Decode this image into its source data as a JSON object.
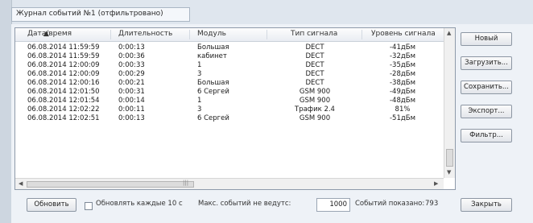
{
  "window": {
    "title": "Журнал событий №1 (отфильтровано)"
  },
  "columns": [
    "Дата/время",
    "Длительность",
    "Модуль",
    "Тип сигнала",
    "Уровень сигнала"
  ],
  "rows": [
    [
      "06.08.2014 11:59:59",
      "0:00:13",
      "Большая",
      "DECT",
      "-41дБм"
    ],
    [
      "06.08.2014 11:59:59",
      "0:00:36",
      "кабинет",
      "DECT",
      "-32дБм"
    ],
    [
      "06.08.2014 12:00:09",
      "0:00:33",
      "1",
      "DECT",
      "-35дБм"
    ],
    [
      "06.08.2014 12:00:09",
      "0:00:29",
      "3",
      "DECT",
      "-28дБм"
    ],
    [
      "06.08.2014 12:00:16",
      "0:00:21",
      "Большая",
      "DECT",
      "-38дБм"
    ],
    [
      "06.08.2014 12:01:50",
      "0:00:31",
      "6 Сергей",
      "GSM 900",
      "-49дБм"
    ],
    [
      "06.08.2014 12:01:54",
      "0:00:14",
      "1",
      "GSM 900",
      "-48дБм"
    ],
    [
      "06.08.2014 12:02:22",
      "0:00:11",
      "3",
      "Трафик 2.4",
      "81%"
    ],
    [
      "06.08.2014 12:02:51",
      "0:00:13",
      "6 Сергей",
      "GSM 900",
      "-51дБм"
    ]
  ],
  "side_buttons": [
    "Новый",
    "Загрузить...",
    "Сохранить...",
    "Экспорт...",
    "Фильтр..."
  ],
  "bottom": {
    "refresh_label": "Обновить",
    "auto_refresh_label": "Обновлять каждые 10 с",
    "max_events_label": "Макс. событий не ведутс:",
    "max_events_value": "1000",
    "events_shown_label": "Событий показано:",
    "events_shown_value": "793",
    "close_label": "Закрыть"
  }
}
